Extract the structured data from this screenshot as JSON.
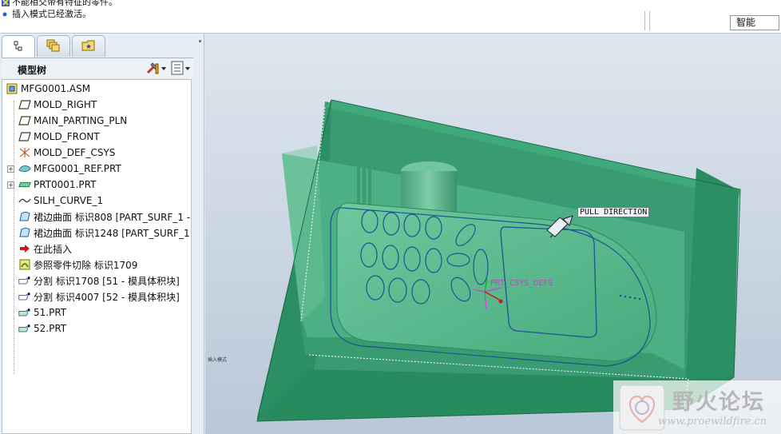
{
  "message_area": {
    "line1": "不能相交带有特征的零件。",
    "line2": "插入模式已经激活。"
  },
  "filter": {
    "value": "智能"
  },
  "model_tree": {
    "title": "模型树",
    "tabs": [
      "model-tree",
      "layers",
      "favorites"
    ],
    "items": [
      {
        "label": "MFG0001.ASM",
        "icon": "assembly-icon",
        "indent": 0,
        "expandable": false
      },
      {
        "label": "MOLD_RIGHT",
        "icon": "datum-plane-icon",
        "indent": 1,
        "expandable": false
      },
      {
        "label": "MAIN_PARTING_PLN",
        "icon": "datum-plane-icon",
        "indent": 1,
        "expandable": false
      },
      {
        "label": "MOLD_FRONT",
        "icon": "datum-plane-icon",
        "indent": 1,
        "expandable": false
      },
      {
        "label": "MOLD_DEF_CSYS",
        "icon": "csys-icon",
        "indent": 1,
        "expandable": false
      },
      {
        "label": "MFG0001_REF.PRT",
        "icon": "reference-part-icon",
        "indent": 1,
        "expandable": true
      },
      {
        "label": "PRT0001.PRT",
        "icon": "part-icon",
        "indent": 1,
        "expandable": true
      },
      {
        "label": "SILH_CURVE_1",
        "icon": "curve-icon",
        "indent": 1,
        "expandable": false
      },
      {
        "label": "裙边曲面 标识808 [PART_SURF_1 -",
        "icon": "skirt-surface-icon",
        "indent": 1,
        "expandable": false
      },
      {
        "label": "裙边曲面 标识1248 [PART_SURF_1",
        "icon": "skirt-surface-icon",
        "indent": 1,
        "expandable": false
      },
      {
        "label": "在此插入",
        "icon": "insert-here-arrow-icon",
        "indent": 1,
        "expandable": false
      },
      {
        "label": "参照零件切除 标识1709",
        "icon": "cutout-icon",
        "indent": 1,
        "expandable": false
      },
      {
        "label": "分割 标识1708 [51 - 模具体积块]",
        "icon": "split-volume-icon",
        "indent": 1,
        "expandable": false
      },
      {
        "label": "分割 标识4007 [52 - 模具体积块]",
        "icon": "split-volume-icon",
        "indent": 1,
        "expandable": false
      },
      {
        "label": "51.PRT",
        "icon": "mold-part-icon",
        "indent": 1,
        "expandable": false
      },
      {
        "label": "52.PRT",
        "icon": "mold-part-icon",
        "indent": 1,
        "expandable": false
      }
    ]
  },
  "viewport": {
    "pull_direction_label": "PULL DIRECTION",
    "csys_label": "PRT_CSYS_DEFS",
    "tiny_label": "插入模式"
  },
  "watermark": {
    "title": "野火论坛",
    "url": "www.proewildfire.cn"
  },
  "colors": {
    "mold_green": "#2f9a6a",
    "part_green": "#6cc49a",
    "panel_bg": "#e7edf4",
    "insert_arrow": "#d01818"
  }
}
